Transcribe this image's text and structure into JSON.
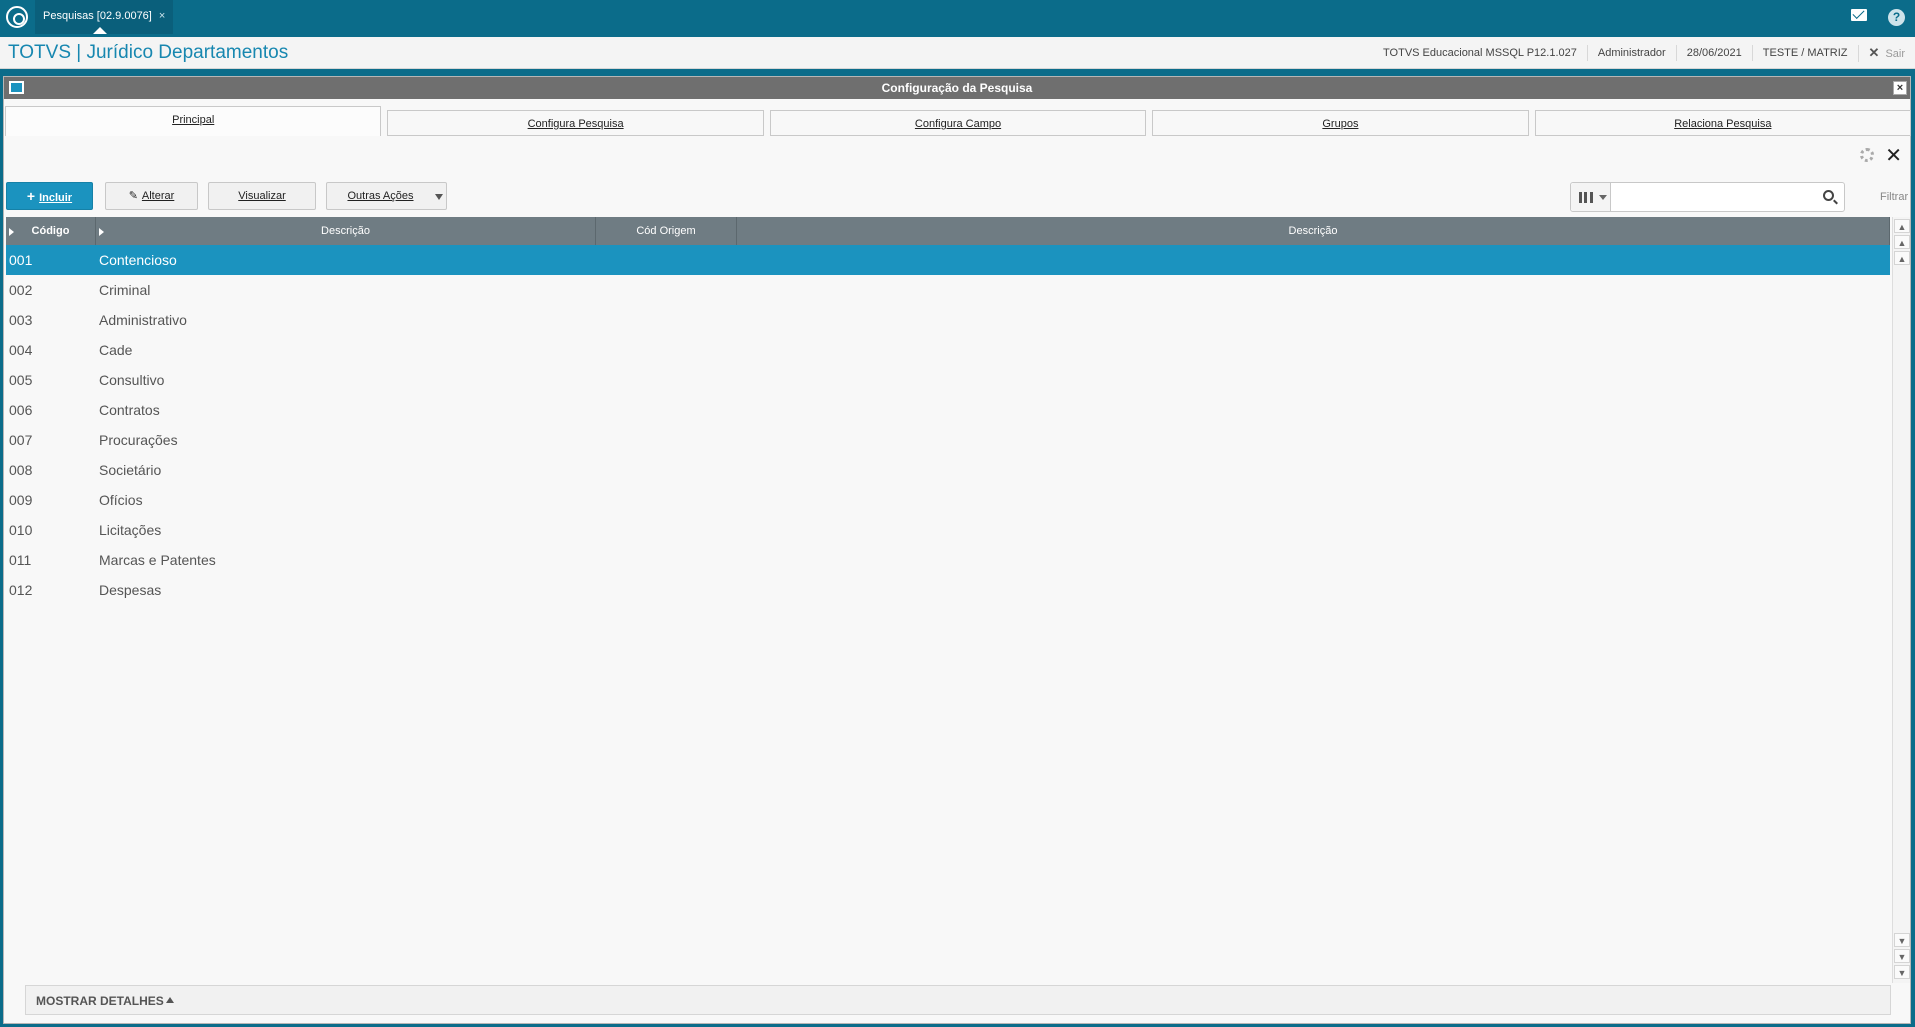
{
  "app_tab": {
    "label": "Pesquisas [02.9.0076]",
    "close": "×"
  },
  "header": {
    "title": "TOTVS | Jurídico Departamentos",
    "environment": "TOTVS Educacional MSSQL P12.1.027",
    "user": "Administrador",
    "date": "28/06/2021",
    "branch": "TESTE / MATRIZ",
    "logout": "Sair"
  },
  "window": {
    "title": "Configuração da Pesquisa",
    "close": "×"
  },
  "tabs": [
    "Principal",
    "Configura Pesquisa",
    "Configura Campo",
    "Grupos",
    "Relaciona Pesquisa"
  ],
  "toolbar": {
    "incluir": "Incluir",
    "alterar": "Alterar",
    "visualizar": "Visualizar",
    "outras_acoes": "Outras Ações"
  },
  "search": {
    "value": "",
    "filter_label": "Filtrar"
  },
  "grid": {
    "columns": [
      "Código",
      "Descrição",
      "Cód Origem",
      "Descrição"
    ],
    "rows": [
      {
        "code": "001",
        "desc": "Contencioso"
      },
      {
        "code": "002",
        "desc": "Criminal"
      },
      {
        "code": "003",
        "desc": "Administrativo"
      },
      {
        "code": "004",
        "desc": "Cade"
      },
      {
        "code": "005",
        "desc": "Consultivo"
      },
      {
        "code": "006",
        "desc": "Contratos"
      },
      {
        "code": "007",
        "desc": "Procurações"
      },
      {
        "code": "008",
        "desc": "Societário"
      },
      {
        "code": "009",
        "desc": "Ofícios"
      },
      {
        "code": "010",
        "desc": "Licitações"
      },
      {
        "code": "011",
        "desc": "Marcas e Patentes"
      },
      {
        "code": "012",
        "desc": "Despesas"
      }
    ],
    "selected_row": 0
  },
  "details": {
    "label": "MOSTRAR DETALHES"
  },
  "colors": {
    "accent": "#1b93bf",
    "topbar": "#0b6c8a",
    "grid_header": "#6f7c83"
  }
}
